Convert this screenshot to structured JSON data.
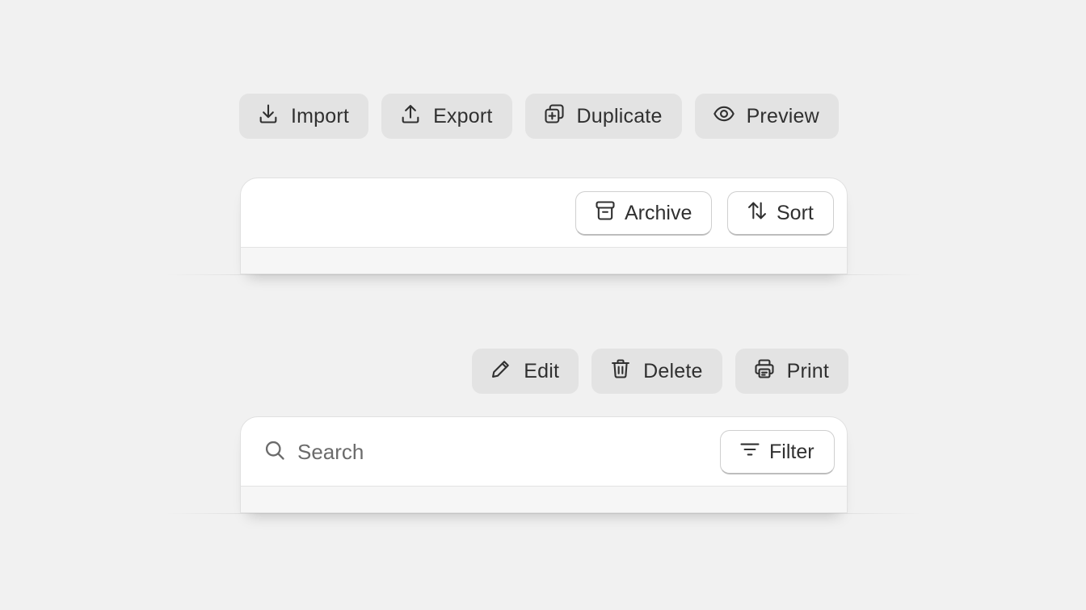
{
  "top_actions": {
    "import_label": "Import",
    "export_label": "Export",
    "duplicate_label": "Duplicate",
    "preview_label": "Preview"
  },
  "card_one": {
    "archive_label": "Archive",
    "sort_label": "Sort"
  },
  "bottom_actions": {
    "edit_label": "Edit",
    "delete_label": "Delete",
    "print_label": "Print"
  },
  "card_two": {
    "search_placeholder": "Search",
    "search_value": "",
    "filter_label": "Filter"
  },
  "icons": {
    "import": "import-icon",
    "export": "export-icon",
    "duplicate": "duplicate-icon",
    "preview": "eye-icon",
    "archive": "archive-icon",
    "sort": "sort-arrows-icon",
    "edit": "pencil-icon",
    "delete": "trash-icon",
    "print": "printer-icon",
    "search": "search-icon",
    "filter": "filter-icon"
  },
  "colors": {
    "background": "#f1f1f1",
    "tinted_button": "#e3e3e3",
    "text": "#303030",
    "card": "#ffffff"
  }
}
